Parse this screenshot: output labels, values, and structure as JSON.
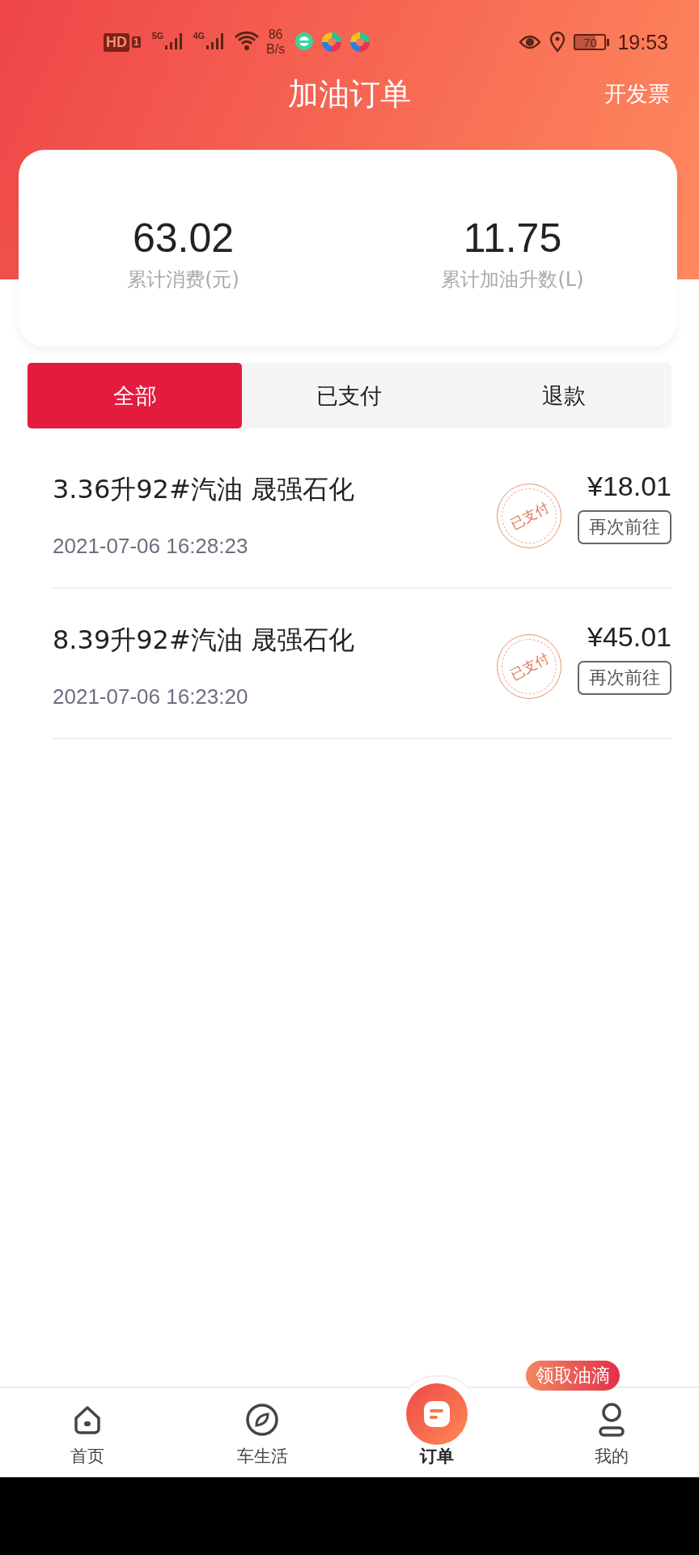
{
  "status_bar": {
    "hd": "HD",
    "sim": "1",
    "signals": [
      "5G",
      "4G"
    ],
    "speed": "86",
    "speed_unit": "B/s",
    "battery": "70",
    "time": "19:53"
  },
  "header": {
    "title": "加油订单",
    "action": "开发票"
  },
  "summary": [
    {
      "value": "63.02",
      "label": "累计消费(元)"
    },
    {
      "value": "11.75",
      "label": "累计加油升数(L)"
    }
  ],
  "tabs": [
    {
      "label": "全部",
      "selected": true
    },
    {
      "label": "已支付",
      "selected": false
    },
    {
      "label": "退款",
      "selected": false
    }
  ],
  "orders": [
    {
      "title": "3.36升92#汽油 晟强石化",
      "time": "2021-07-06 16:28:23",
      "stamp": "已支付",
      "price": "¥18.01",
      "button": "再次前往"
    },
    {
      "title": "8.39升92#汽油 晟强石化",
      "time": "2021-07-06 16:23:20",
      "stamp": "已支付",
      "price": "¥45.01",
      "button": "再次前往"
    }
  ],
  "bottom_nav": {
    "badge": "领取油滴",
    "items": [
      {
        "kind": "home",
        "label": "首页",
        "selected": false
      },
      {
        "kind": "compass",
        "label": "车生活",
        "selected": false
      },
      {
        "kind": "order",
        "label": "订单",
        "selected": true
      },
      {
        "kind": "user",
        "label": "我的",
        "selected": false
      }
    ]
  }
}
